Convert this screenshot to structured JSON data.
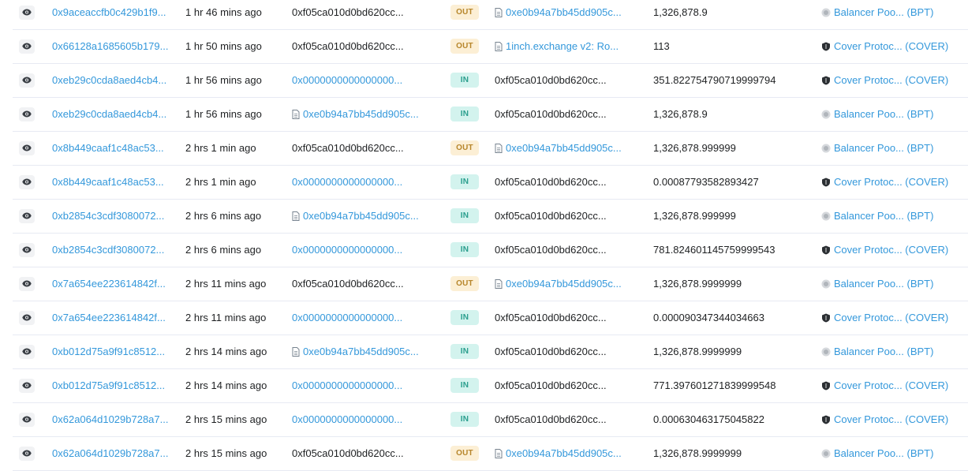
{
  "colors": {
    "link": "#3498db",
    "text": "#1e2022",
    "out_bg": "#fcefd5",
    "out_fg": "#b7862b",
    "in_bg": "#d3f3ee",
    "in_fg": "#2a9e8d"
  },
  "rows": [
    {
      "hash": "0x9aceaccfb0c429b1f9...",
      "age": "1 hr 46 mins ago",
      "from": "0xf05ca010d0bd620cc...",
      "from_link": false,
      "from_contract": false,
      "dir": "OUT",
      "to": "0xe0b94a7bb45dd905c...",
      "to_link": true,
      "to_contract": true,
      "value": "1,326,878.9",
      "token": "Balancer Poo... (BPT)",
      "token_icon": "balancer-token-icon"
    },
    {
      "hash": "0x66128a1685605b179...",
      "age": "1 hr 50 mins ago",
      "from": "0xf05ca010d0bd620cc...",
      "from_link": false,
      "from_contract": false,
      "dir": "OUT",
      "to": "1inch.exchange v2: Ro...",
      "to_link": true,
      "to_contract": true,
      "value": "113",
      "token": "Cover Protoc... (COVER)",
      "token_icon": "cover-shield-icon"
    },
    {
      "hash": "0xeb29c0cda8aed4cb4...",
      "age": "1 hr 56 mins ago",
      "from": "0x0000000000000000...",
      "from_link": true,
      "from_contract": false,
      "dir": "IN",
      "to": "0xf05ca010d0bd620cc...",
      "to_link": false,
      "to_contract": false,
      "value": "351.822754790719999794",
      "token": "Cover Protoc... (COVER)",
      "token_icon": "cover-shield-icon"
    },
    {
      "hash": "0xeb29c0cda8aed4cb4...",
      "age": "1 hr 56 mins ago",
      "from": "0xe0b94a7bb45dd905c...",
      "from_link": true,
      "from_contract": true,
      "dir": "IN",
      "to": "0xf05ca010d0bd620cc...",
      "to_link": false,
      "to_contract": false,
      "value": "1,326,878.9",
      "token": "Balancer Poo... (BPT)",
      "token_icon": "balancer-token-icon"
    },
    {
      "hash": "0x8b449caaf1c48ac53...",
      "age": "2 hrs 1 min ago",
      "from": "0xf05ca010d0bd620cc...",
      "from_link": false,
      "from_contract": false,
      "dir": "OUT",
      "to": "0xe0b94a7bb45dd905c...",
      "to_link": true,
      "to_contract": true,
      "value": "1,326,878.999999",
      "token": "Balancer Poo... (BPT)",
      "token_icon": "balancer-token-icon"
    },
    {
      "hash": "0x8b449caaf1c48ac53...",
      "age": "2 hrs 1 min ago",
      "from": "0x0000000000000000...",
      "from_link": true,
      "from_contract": false,
      "dir": "IN",
      "to": "0xf05ca010d0bd620cc...",
      "to_link": false,
      "to_contract": false,
      "value": "0.00087793582893427",
      "token": "Cover Protoc... (COVER)",
      "token_icon": "cover-shield-icon"
    },
    {
      "hash": "0xb2854c3cdf3080072...",
      "age": "2 hrs 6 mins ago",
      "from": "0xe0b94a7bb45dd905c...",
      "from_link": true,
      "from_contract": true,
      "dir": "IN",
      "to": "0xf05ca010d0bd620cc...",
      "to_link": false,
      "to_contract": false,
      "value": "1,326,878.999999",
      "token": "Balancer Poo... (BPT)",
      "token_icon": "balancer-token-icon"
    },
    {
      "hash": "0xb2854c3cdf3080072...",
      "age": "2 hrs 6 mins ago",
      "from": "0x0000000000000000...",
      "from_link": true,
      "from_contract": false,
      "dir": "IN",
      "to": "0xf05ca010d0bd620cc...",
      "to_link": false,
      "to_contract": false,
      "value": "781.824601145759999543",
      "token": "Cover Protoc... (COVER)",
      "token_icon": "cover-shield-icon"
    },
    {
      "hash": "0x7a654ee223614842f...",
      "age": "2 hrs 11 mins ago",
      "from": "0xf05ca010d0bd620cc...",
      "from_link": false,
      "from_contract": false,
      "dir": "OUT",
      "to": "0xe0b94a7bb45dd905c...",
      "to_link": true,
      "to_contract": true,
      "value": "1,326,878.9999999",
      "token": "Balancer Poo... (BPT)",
      "token_icon": "balancer-token-icon"
    },
    {
      "hash": "0x7a654ee223614842f...",
      "age": "2 hrs 11 mins ago",
      "from": "0x0000000000000000...",
      "from_link": true,
      "from_contract": false,
      "dir": "IN",
      "to": "0xf05ca010d0bd620cc...",
      "to_link": false,
      "to_contract": false,
      "value": "0.000090347344034663",
      "token": "Cover Protoc... (COVER)",
      "token_icon": "cover-shield-icon"
    },
    {
      "hash": "0xb012d75a9f91c8512...",
      "age": "2 hrs 14 mins ago",
      "from": "0xe0b94a7bb45dd905c...",
      "from_link": true,
      "from_contract": true,
      "dir": "IN",
      "to": "0xf05ca010d0bd620cc...",
      "to_link": false,
      "to_contract": false,
      "value": "1,326,878.9999999",
      "token": "Balancer Poo... (BPT)",
      "token_icon": "balancer-token-icon"
    },
    {
      "hash": "0xb012d75a9f91c8512...",
      "age": "2 hrs 14 mins ago",
      "from": "0x0000000000000000...",
      "from_link": true,
      "from_contract": false,
      "dir": "IN",
      "to": "0xf05ca010d0bd620cc...",
      "to_link": false,
      "to_contract": false,
      "value": "771.397601271839999548",
      "token": "Cover Protoc... (COVER)",
      "token_icon": "cover-shield-icon"
    },
    {
      "hash": "0x62a064d1029b728a7...",
      "age": "2 hrs 15 mins ago",
      "from": "0x0000000000000000...",
      "from_link": true,
      "from_contract": false,
      "dir": "IN",
      "to": "0xf05ca010d0bd620cc...",
      "to_link": false,
      "to_contract": false,
      "value": "0.000630463175045822",
      "token": "Cover Protoc... (COVER)",
      "token_icon": "cover-shield-icon"
    },
    {
      "hash": "0x62a064d1029b728a7...",
      "age": "2 hrs 15 mins ago",
      "from": "0xf05ca010d0bd620cc...",
      "from_link": false,
      "from_contract": false,
      "dir": "OUT",
      "to": "0xe0b94a7bb45dd905c...",
      "to_link": true,
      "to_contract": true,
      "value": "1,326,878.9999999",
      "token": "Balancer Poo... (BPT)",
      "token_icon": "balancer-token-icon"
    }
  ]
}
